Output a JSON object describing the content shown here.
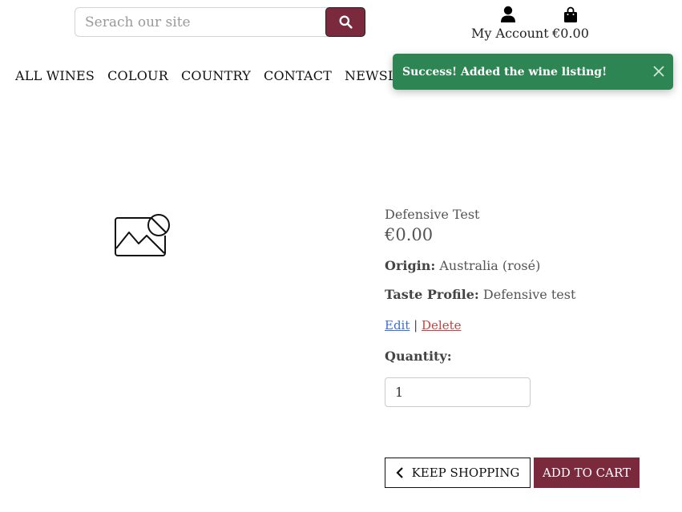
{
  "header": {
    "search": {
      "placeholder": "Serach our site",
      "button_icon": "search-icon"
    },
    "account": {
      "label": "My Account",
      "icon": "user-icon"
    },
    "cart": {
      "total": "€0.00",
      "icon": "shopping-bag-icon"
    }
  },
  "nav": {
    "items": [
      "ALL WINES",
      "COLOUR",
      "COUNTRY",
      "CONTACT",
      "NEWSLETTER"
    ]
  },
  "toast": {
    "message": "Success! Added the wine listing!",
    "color": "#2e8554"
  },
  "product": {
    "image": "no-image-icon",
    "name": "Defensive Test",
    "price": "€0.00",
    "origin_label": "Origin:",
    "origin_value": "Australia (rosé)",
    "taste_label": "Taste Profile:",
    "taste_value": "Defensive test",
    "edit_label": "Edit",
    "separator": "|",
    "delete_label": "Delete",
    "quantity_label": "Quantity:",
    "quantity_value": "1"
  },
  "actions": {
    "keep_shopping": "KEEP SHOPPING",
    "add_to_cart": "ADD TO CART"
  },
  "colors": {
    "brand": "#7b2a3e",
    "success": "#2e8554",
    "edit_link": "#3b6fd8",
    "delete_link": "#c0443f"
  }
}
